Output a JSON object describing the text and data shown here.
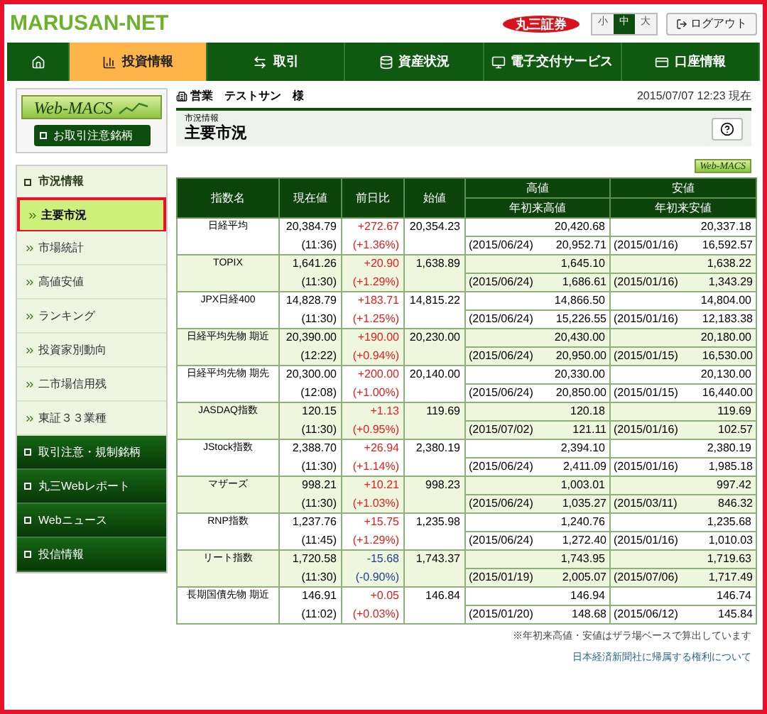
{
  "header": {
    "logo": "MARUSAN-NET",
    "brand_badge": "丸三証券",
    "font_sizes": [
      {
        "label": "小",
        "selected": false
      },
      {
        "label": "中",
        "selected": true
      },
      {
        "label": "大",
        "selected": false
      }
    ],
    "logout": "ログアウト"
  },
  "nav": [
    {
      "kind": "home",
      "selected": false
    },
    {
      "kind": "chart",
      "label": "投資情報",
      "selected": true
    },
    {
      "kind": "trade",
      "label": "取引",
      "selected": false
    },
    {
      "kind": "assets",
      "label": "資産状況",
      "selected": false
    },
    {
      "kind": "monitor",
      "label": "電子交付サービス",
      "selected": false
    },
    {
      "kind": "account",
      "label": "口座情報",
      "selected": false
    }
  ],
  "sidebar": {
    "webmacs_logo": "Web-MACS",
    "caution_button": "お取引注意銘柄",
    "section": "市況情報",
    "items": [
      {
        "label": "主要市況",
        "selected": true
      },
      {
        "label": "市場統計",
        "selected": false
      },
      {
        "label": "高値安値",
        "selected": false
      },
      {
        "label": "ランキング",
        "selected": false
      },
      {
        "label": "投資家別動向",
        "selected": false
      },
      {
        "label": "二市場信用残",
        "selected": false
      },
      {
        "label": "東証３３業種",
        "selected": false
      }
    ],
    "links": [
      "取引注意・規制銘柄",
      "丸三Webレポート",
      "Webニュース",
      "投信情報"
    ]
  },
  "user": "営業　テストサン　様",
  "timestamp": "2015/07/07 12:23 現在",
  "page": {
    "category": "市況情報",
    "title": "主要市況"
  },
  "webmacs_badge": "Web-MACS",
  "table": {
    "columns": [
      "指数名",
      "現在値",
      "前日比",
      "始値"
    ],
    "high": {
      "label": "高値",
      "sub": "年初来高値"
    },
    "low": {
      "label": "安値",
      "sub": "年初来安値"
    },
    "rows": [
      {
        "name": "日経平均",
        "price": "20,384.79",
        "time": "(11:36)",
        "change": "+272.67",
        "change_pct": "(+1.36%)",
        "kind": "up",
        "open": "20,354.23",
        "high": "20,420.68",
        "high_date": "(2015/06/24)",
        "ytd_high": "20,952.71",
        "low": "20,337.18",
        "low_date": "(2015/01/16)",
        "ytd_low": "16,592.57"
      },
      {
        "name": "TOPIX",
        "price": "1,641.26",
        "time": "(11:30)",
        "change": "+20.90",
        "change_pct": "(+1.29%)",
        "kind": "up",
        "open": "1,638.89",
        "high": "1,645.10",
        "high_date": "(2015/06/24)",
        "ytd_high": "1,686.61",
        "low": "1,638.22",
        "low_date": "(2015/01/16)",
        "ytd_low": "1,343.29"
      },
      {
        "name": "JPX日経400",
        "price": "14,828.79",
        "time": "(11:30)",
        "change": "+183.71",
        "change_pct": "(+1.25%)",
        "kind": "up",
        "open": "14,815.22",
        "high": "14,866.50",
        "high_date": "(2015/06/24)",
        "ytd_high": "15,226.55",
        "low": "14,804.00",
        "low_date": "(2015/01/16)",
        "ytd_low": "12,183.38"
      },
      {
        "name": "日経平均先物 期近",
        "price": "20,390.00",
        "time": "(12:22)",
        "change": "+190.00",
        "change_pct": "(+0.94%)",
        "kind": "up",
        "open": "20,230.00",
        "high": "20,430.00",
        "high_date": "(2015/06/24)",
        "ytd_high": "20,950.00",
        "low": "20,180.00",
        "low_date": "(2015/01/15)",
        "ytd_low": "16,530.00"
      },
      {
        "name": "日経平均先物 期先",
        "price": "20,300.00",
        "time": "(12:08)",
        "change": "+200.00",
        "change_pct": "(+1.00%)",
        "kind": "up",
        "open": "20,140.00",
        "high": "20,330.00",
        "high_date": "(2015/06/24)",
        "ytd_high": "20,850.00",
        "low": "20,130.00",
        "low_date": "(2015/01/15)",
        "ytd_low": "16,440.00"
      },
      {
        "name": "JASDAQ指数",
        "price": "120.15",
        "time": "(11:30)",
        "change": "+1.13",
        "change_pct": "(+0.95%)",
        "kind": "up",
        "open": "119.69",
        "high": "120.18",
        "high_date": "(2015/07/02)",
        "ytd_high": "121.11",
        "low": "119.69",
        "low_date": "(2015/01/16)",
        "ytd_low": "102.57"
      },
      {
        "name": "JStock指数",
        "price": "2,388.70",
        "time": "(11:30)",
        "change": "+26.94",
        "change_pct": "(+1.14%)",
        "kind": "up",
        "open": "2,380.19",
        "high": "2,394.10",
        "high_date": "(2015/06/24)",
        "ytd_high": "2,411.09",
        "low": "2,380.19",
        "low_date": "(2015/01/16)",
        "ytd_low": "1,985.18"
      },
      {
        "name": "マザーズ",
        "price": "998.21",
        "time": "(11:30)",
        "change": "+10.21",
        "change_pct": "(+1.03%)",
        "kind": "up",
        "open": "998.23",
        "high": "1,003.01",
        "high_date": "(2015/06/24)",
        "ytd_high": "1,035.27",
        "low": "997.42",
        "low_date": "(2015/03/11)",
        "ytd_low": "846.32"
      },
      {
        "name": "RNP指数",
        "price": "1,237.76",
        "time": "(11:45)",
        "change": "+15.75",
        "change_pct": "(+1.29%)",
        "kind": "up",
        "open": "1,235.98",
        "high": "1,240.76",
        "high_date": "(2015/06/24)",
        "ytd_high": "1,272.40",
        "low": "1,235.68",
        "low_date": "(2015/01/16)",
        "ytd_low": "1,010.03"
      },
      {
        "name": "リート指数",
        "price": "1,720.58",
        "time": "(11:30)",
        "change": "-15.68",
        "change_pct": "(-0.90%)",
        "kind": "down",
        "open": "1,743.37",
        "high": "1,743.95",
        "high_date": "(2015/01/19)",
        "ytd_high": "2,005.07",
        "low": "1,719.63",
        "low_date": "(2015/07/06)",
        "ytd_low": "1,717.49"
      },
      {
        "name": "長期国債先物 期近",
        "price": "146.91",
        "time": "(11:02)",
        "change": "+0.05",
        "change_pct": "(+0.03%)",
        "kind": "up",
        "open": "146.84",
        "high": "146.94",
        "high_date": "(2015/01/20)",
        "ytd_high": "148.68",
        "low": "146.74",
        "low_date": "(2015/06/12)",
        "ytd_low": "145.84"
      }
    ]
  },
  "footnote": "※年初来高値・安値はザラ場ベースで算出しています",
  "rights_link": "日本経済新聞社に帰属する権利について"
}
